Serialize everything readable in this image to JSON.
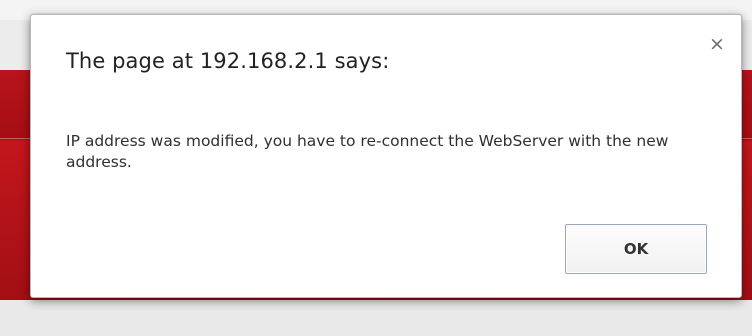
{
  "dialog": {
    "title": "The page at 192.168.2.1 says:",
    "message": "IP address was modified, you have to re-connect the WebServer with the new address.",
    "ok_label": "OK",
    "close_glyph": "×"
  },
  "colors": {
    "background_accent": "#b8141a",
    "dialog_background": "#ffffff"
  }
}
